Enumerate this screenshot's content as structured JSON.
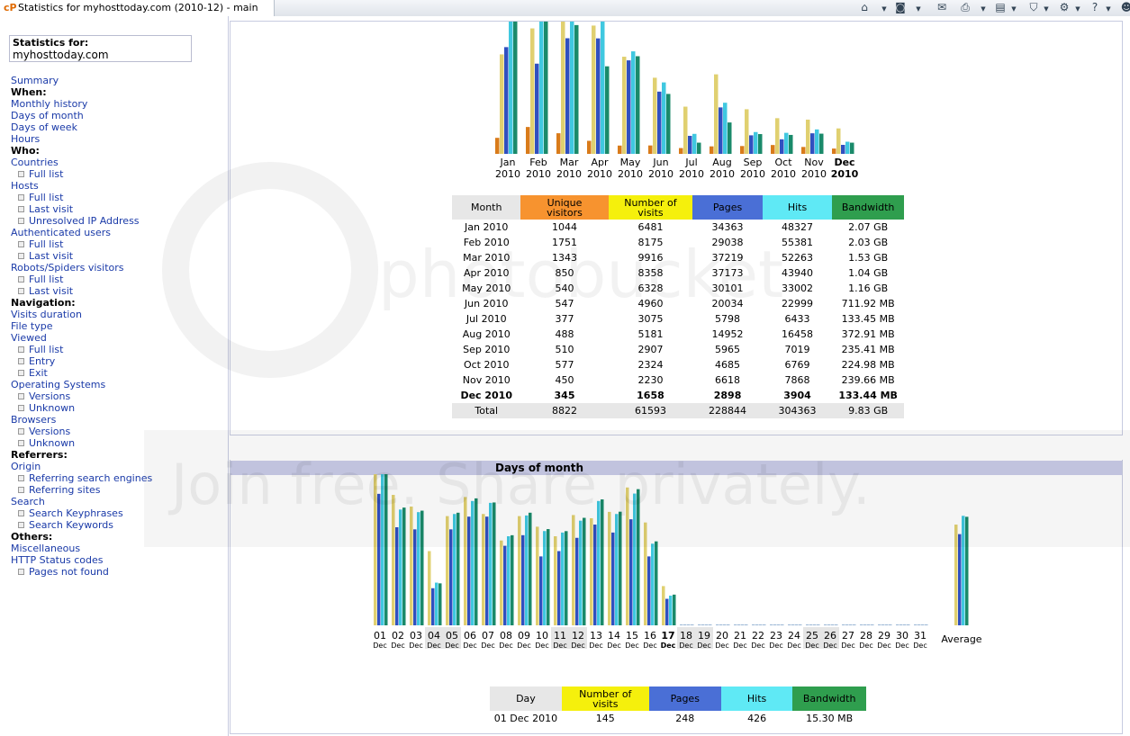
{
  "browser": {
    "tab_title": "Statistics for myhosttoday.com (2010-12) - main",
    "tab_icon": "cP"
  },
  "sidebar": {
    "stats_for_label": "Statistics for:",
    "site": "myhosttoday.com",
    "items": [
      {
        "label": "Summary",
        "type": "link"
      },
      {
        "label": "When:",
        "type": "heading"
      },
      {
        "label": "Monthly history",
        "type": "link"
      },
      {
        "label": "Days of month",
        "type": "link"
      },
      {
        "label": "Days of week",
        "type": "link"
      },
      {
        "label": "Hours",
        "type": "link"
      },
      {
        "label": "Who:",
        "type": "heading"
      },
      {
        "label": "Countries",
        "type": "link"
      },
      {
        "label": "Full list",
        "type": "sub"
      },
      {
        "label": "Hosts",
        "type": "link"
      },
      {
        "label": "Full list",
        "type": "sub"
      },
      {
        "label": "Last visit",
        "type": "sub"
      },
      {
        "label": "Unresolved IP Address",
        "type": "sub"
      },
      {
        "label": "Authenticated users",
        "type": "link"
      },
      {
        "label": "Full list",
        "type": "sub"
      },
      {
        "label": "Last visit",
        "type": "sub"
      },
      {
        "label": "Robots/Spiders visitors",
        "type": "link"
      },
      {
        "label": "Full list",
        "type": "sub"
      },
      {
        "label": "Last visit",
        "type": "sub"
      },
      {
        "label": "Navigation:",
        "type": "heading"
      },
      {
        "label": "Visits duration",
        "type": "link"
      },
      {
        "label": "File type",
        "type": "link"
      },
      {
        "label": "Viewed",
        "type": "link"
      },
      {
        "label": "Full list",
        "type": "sub"
      },
      {
        "label": "Entry",
        "type": "sub"
      },
      {
        "label": "Exit",
        "type": "sub"
      },
      {
        "label": "Operating Systems",
        "type": "link"
      },
      {
        "label": "Versions",
        "type": "sub"
      },
      {
        "label": "Unknown",
        "type": "sub"
      },
      {
        "label": "Browsers",
        "type": "link"
      },
      {
        "label": "Versions",
        "type": "sub"
      },
      {
        "label": "Unknown",
        "type": "sub"
      },
      {
        "label": "Referrers:",
        "type": "heading"
      },
      {
        "label": "Origin",
        "type": "link"
      },
      {
        "label": "Referring search engines",
        "type": "sub"
      },
      {
        "label": "Referring sites",
        "type": "sub"
      },
      {
        "label": "Search",
        "type": "link"
      },
      {
        "label": "Search Keyphrases",
        "type": "sub"
      },
      {
        "label": "Search Keywords",
        "type": "sub"
      },
      {
        "label": "Others:",
        "type": "heading"
      },
      {
        "label": "Miscellaneous",
        "type": "link"
      },
      {
        "label": "HTTP Status codes",
        "type": "link"
      },
      {
        "label": "Pages not found",
        "type": "sub"
      }
    ]
  },
  "colors": {
    "unique_visitors": "#f7932f",
    "visits": "#f5f00c",
    "pages": "#4a6fd6",
    "hits": "#5fe9f5",
    "bandwidth": "#2f9e4e",
    "bar_unique": "#d97b1a",
    "bar_visits": "#e0d070",
    "bar_pages": "#3050c0",
    "bar_hits": "#40c8e0",
    "bar_bandwidth": "#1a8a6a"
  },
  "monthly": {
    "headers": [
      "Month",
      "Unique visitors",
      "Number of visits",
      "Pages",
      "Hits",
      "Bandwidth"
    ],
    "rows": [
      {
        "month": "Jan 2010",
        "unique": "1044",
        "visits": "6481",
        "pages": "34363",
        "hits": "48327",
        "bandwidth": "2.07 GB"
      },
      {
        "month": "Feb 2010",
        "unique": "1751",
        "visits": "8175",
        "pages": "29038",
        "hits": "55381",
        "bandwidth": "2.03 GB"
      },
      {
        "month": "Mar 2010",
        "unique": "1343",
        "visits": "9916",
        "pages": "37219",
        "hits": "52263",
        "bandwidth": "1.53 GB"
      },
      {
        "month": "Apr 2010",
        "unique": "850",
        "visits": "8358",
        "pages": "37173",
        "hits": "43940",
        "bandwidth": "1.04 GB"
      },
      {
        "month": "May 2010",
        "unique": "540",
        "visits": "6328",
        "pages": "30101",
        "hits": "33002",
        "bandwidth": "1.16 GB"
      },
      {
        "month": "Jun 2010",
        "unique": "547",
        "visits": "4960",
        "pages": "20034",
        "hits": "22999",
        "bandwidth": "711.92 MB"
      },
      {
        "month": "Jul 2010",
        "unique": "377",
        "visits": "3075",
        "pages": "5798",
        "hits": "6433",
        "bandwidth": "133.45 MB"
      },
      {
        "month": "Aug 2010",
        "unique": "488",
        "visits": "5181",
        "pages": "14952",
        "hits": "16458",
        "bandwidth": "372.91 MB"
      },
      {
        "month": "Sep 2010",
        "unique": "510",
        "visits": "2907",
        "pages": "5965",
        "hits": "7019",
        "bandwidth": "235.41 MB"
      },
      {
        "month": "Oct 2010",
        "unique": "577",
        "visits": "2324",
        "pages": "4685",
        "hits": "6769",
        "bandwidth": "224.98 MB"
      },
      {
        "month": "Nov 2010",
        "unique": "450",
        "visits": "2230",
        "pages": "6618",
        "hits": "7868",
        "bandwidth": "239.66 MB"
      },
      {
        "month": "Dec 2010",
        "unique": "345",
        "visits": "1658",
        "pages": "2898",
        "hits": "3904",
        "bandwidth": "133.44 MB"
      }
    ],
    "total": {
      "month": "Total",
      "unique": "8822",
      "visits": "61593",
      "pages": "228844",
      "hits": "304363",
      "bandwidth": "9.83 GB"
    },
    "axis_months": [
      "Jan",
      "Feb",
      "Mar",
      "Apr",
      "May",
      "Jun",
      "Jul",
      "Aug",
      "Sep",
      "Oct",
      "Nov",
      "Dec"
    ],
    "axis_year": "2010"
  },
  "days_of_month": {
    "title": "Days of month",
    "average_label": "Average",
    "month_abbr": "Dec",
    "headers": [
      "Day",
      "Number of visits",
      "Pages",
      "Hits",
      "Bandwidth"
    ],
    "first_row": {
      "day": "01 Dec 2010",
      "visits": "145",
      "pages": "248",
      "hits": "426",
      "bandwidth": "15.30 MB"
    }
  },
  "chart_data": [
    {
      "type": "bar",
      "categories": [
        "Jan 2010",
        "Feb 2010",
        "Mar 2010",
        "Apr 2010",
        "May 2010",
        "Jun 2010",
        "Jul 2010",
        "Aug 2010",
        "Sep 2010",
        "Oct 2010",
        "Nov 2010",
        "Dec 2010"
      ],
      "series": [
        {
          "name": "Unique visitors",
          "values": [
            1044,
            1751,
            1343,
            850,
            540,
            547,
            377,
            488,
            510,
            577,
            450,
            345
          ]
        },
        {
          "name": "Number of visits",
          "values": [
            6481,
            8175,
            9916,
            8358,
            6328,
            4960,
            3075,
            5181,
            2907,
            2324,
            2230,
            1658
          ]
        },
        {
          "name": "Pages",
          "values": [
            34363,
            29038,
            37219,
            37173,
            30101,
            20034,
            5798,
            14952,
            5965,
            4685,
            6618,
            2898
          ]
        },
        {
          "name": "Hits",
          "values": [
            48327,
            55381,
            52263,
            43940,
            33002,
            22999,
            6433,
            16458,
            7019,
            6769,
            7868,
            3904
          ]
        },
        {
          "name": "Bandwidth",
          "values": [
            2.07,
            2.03,
            1.53,
            1.04,
            1.16,
            0.712,
            0.133,
            0.373,
            0.235,
            0.225,
            0.24,
            0.133
          ]
        }
      ]
    },
    {
      "type": "bar",
      "categories": [
        "01",
        "02",
        "03",
        "04",
        "05",
        "06",
        "07",
        "08",
        "09",
        "10",
        "11",
        "12",
        "13",
        "14",
        "15",
        "16",
        "17",
        "18",
        "19",
        "20",
        "21",
        "22",
        "23",
        "24",
        "25",
        "26",
        "27",
        "28",
        "29",
        "30",
        "31",
        "Average"
      ],
      "series": [
        {
          "name": "Number of visits",
          "values": [
            145,
            123,
            112,
            70,
            103,
            121,
            105,
            80,
            103,
            93,
            84,
            104,
            101,
            107,
            130,
            97,
            37,
            0,
            0,
            0,
            0,
            0,
            0,
            0,
            0,
            0,
            0,
            0,
            0,
            0,
            0,
            95
          ]
        },
        {
          "name": "Pages",
          "values": [
            248,
            185,
            181,
            70,
            181,
            205,
            205,
            150,
            170,
            130,
            140,
            165,
            190,
            175,
            200,
            130,
            50,
            0,
            0,
            0,
            0,
            0,
            0,
            0,
            0,
            0,
            0,
            0,
            0,
            0,
            0,
            172
          ]
        },
        {
          "name": "Hits",
          "values": [
            426,
            312,
            305,
            115,
            300,
            335,
            330,
            240,
            296,
            254,
            250,
            282,
            335,
            300,
            355,
            220,
            80,
            0,
            0,
            0,
            0,
            0,
            0,
            0,
            0,
            0,
            0,
            0,
            0,
            0,
            0,
            295
          ]
        },
        {
          "name": "Bandwidth",
          "values": [
            15.3,
            11.5,
            11.2,
            4.1,
            11.0,
            12.4,
            12.0,
            8.8,
            11.0,
            9.4,
            9.2,
            10.5,
            12.3,
            11.1,
            13.3,
            8.2,
            3.0,
            0,
            0,
            0,
            0,
            0,
            0,
            0,
            0,
            0,
            0,
            0,
            0,
            0,
            0,
            10.6
          ]
        }
      ],
      "weekend_days": [
        "04",
        "05",
        "11",
        "12",
        "18",
        "19",
        "25",
        "26"
      ],
      "highlight_day": "17"
    }
  ],
  "watermark": {
    "brand": "photobucket",
    "slogan": "Join free. Share privately."
  }
}
